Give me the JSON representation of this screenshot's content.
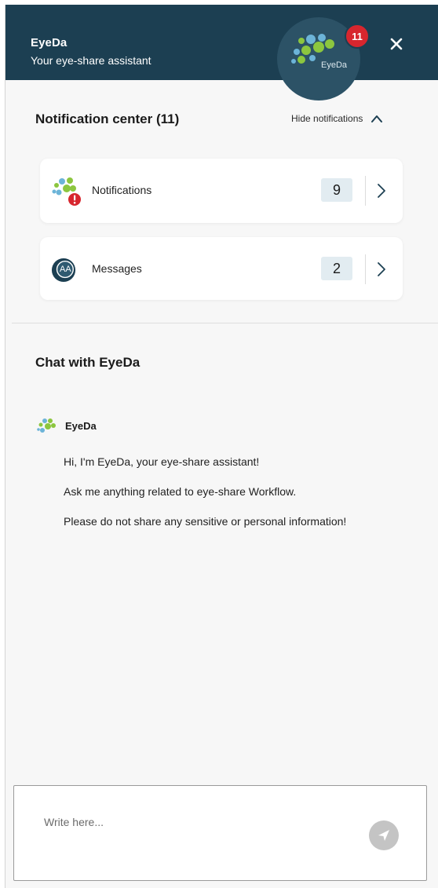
{
  "header": {
    "title": "EyeDa",
    "subtitle": "Your eye-share assistant",
    "avatar_text": "EyeDa",
    "badge_count": "11",
    "bg_color": "#1c3f52"
  },
  "notification_center": {
    "title": "Notification center (11)",
    "toggle_label": "Hide notifications",
    "items": [
      {
        "label": "Notifications",
        "count": "9",
        "icon": "eyeda-alert-icon"
      },
      {
        "label": "Messages",
        "count": "2",
        "icon": "messages-avatar-icon",
        "avatar_initials": "AA"
      }
    ]
  },
  "chat": {
    "title": "Chat with EyeDa",
    "bot_name": "EyeDa",
    "messages": [
      "Hi, I'm EyeDa, your eye-share assistant!",
      "Ask me anything related to eye-share Workflow.",
      "Please do not share any sensitive or personal information!"
    ]
  },
  "composer": {
    "placeholder": "Write here...",
    "value": ""
  },
  "colors": {
    "badge": "#d7262e",
    "logo_green": "#8cc63f",
    "logo_blue": "#6cb4d8",
    "count_bg": "#e2ecf1"
  }
}
